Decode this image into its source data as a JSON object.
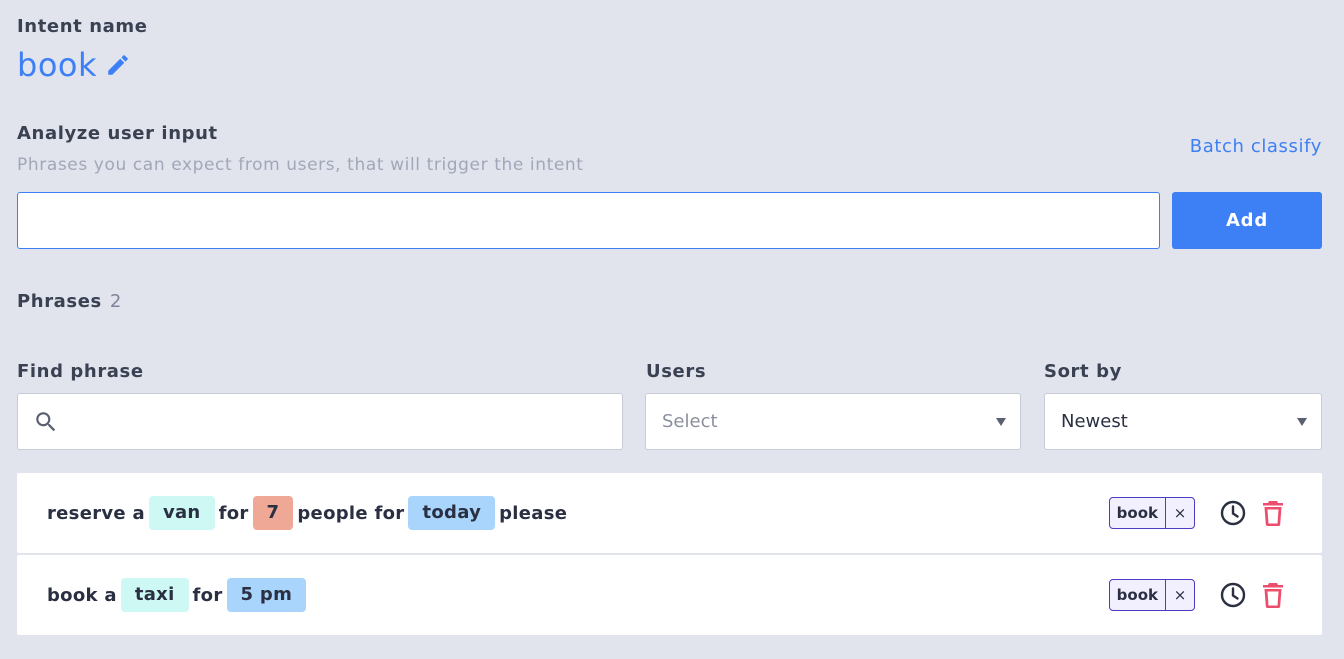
{
  "intent": {
    "section_label": "Intent name",
    "name": "book"
  },
  "analyze": {
    "section_label": "Analyze user input",
    "subtitle": "Phrases you can expect from users, that will trigger the intent",
    "batch_link": "Batch classify",
    "input_value": "",
    "add_label": "Add"
  },
  "phrases": {
    "title": "Phrases",
    "count": "2"
  },
  "filters": {
    "find_label": "Find phrase",
    "find_value": "",
    "users_label": "Users",
    "users_selected": "Select",
    "sort_label": "Sort by",
    "sort_selected": "Newest"
  },
  "phrase_list": [
    {
      "tokens": [
        {
          "text": "reserve a",
          "entity": null
        },
        {
          "text": "van",
          "entity": "vehicle"
        },
        {
          "text": "for",
          "entity": null
        },
        {
          "text": "7",
          "entity": "number"
        },
        {
          "text": "people for",
          "entity": null
        },
        {
          "text": "today",
          "entity": "time"
        },
        {
          "text": "please",
          "entity": null
        }
      ],
      "intent_tag": "book",
      "close_glyph": "×"
    },
    {
      "tokens": [
        {
          "text": "book a",
          "entity": null
        },
        {
          "text": "taxi",
          "entity": "vehicle"
        },
        {
          "text": "for",
          "entity": null
        },
        {
          "text": "5 pm",
          "entity": "time"
        }
      ],
      "intent_tag": "book",
      "close_glyph": "×"
    }
  ],
  "colors": {
    "accent": "#3d7ff5",
    "background": "#e1e4ed",
    "entity_vehicle": "#cdf8f3",
    "entity_number": "#efa895",
    "entity_time": "#a9d4fb",
    "delete": "#ec4f6e",
    "intent_tag_border": "#4b3cc4"
  },
  "icons": {
    "edit": "pencil-icon",
    "search": "search-icon",
    "history": "clock-icon",
    "delete": "trash-icon",
    "dropdown": "caret-down-icon"
  }
}
